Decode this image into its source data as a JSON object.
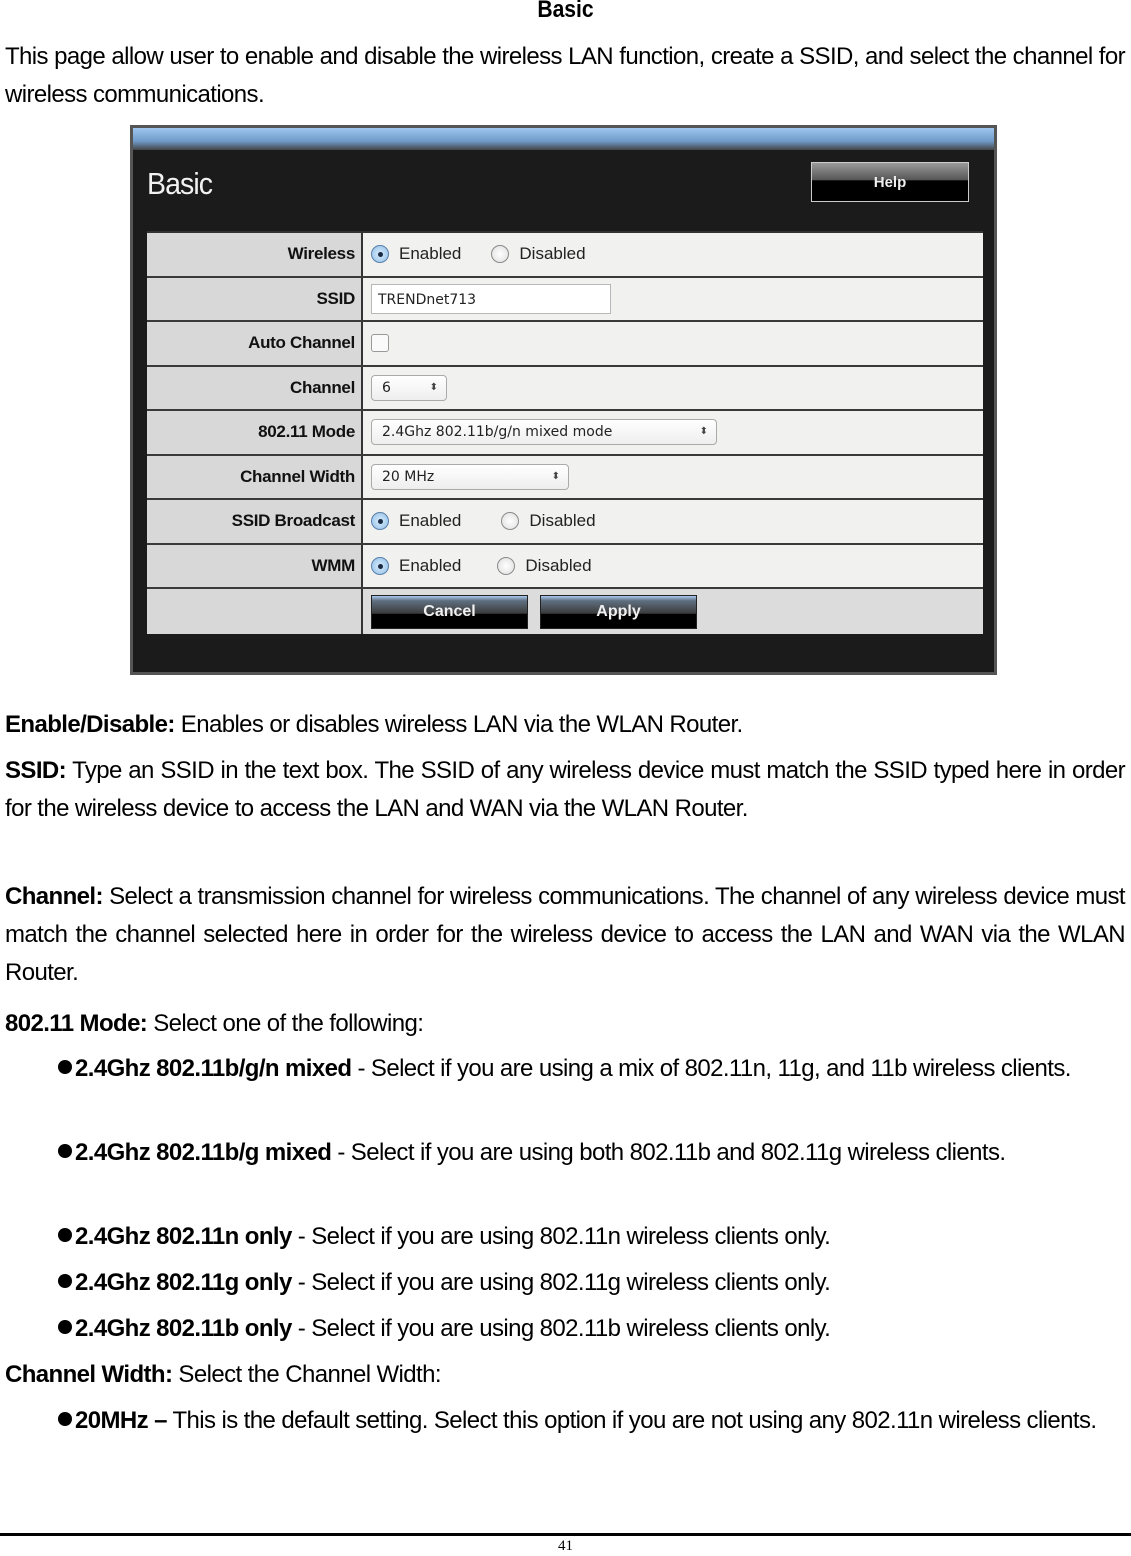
{
  "doc_title": "Basic",
  "intro": "This page allow user to enable and disable the wireless LAN function, create a SSID, and select the channel for wireless communications.",
  "screenshot": {
    "title": "Basic",
    "help_button": "Help",
    "rows": {
      "wireless": {
        "label": "Wireless",
        "options": [
          "Enabled",
          "Disabled"
        ],
        "selected": "Enabled"
      },
      "ssid": {
        "label": "SSID",
        "value": "TRENDnet713"
      },
      "auto_channel": {
        "label": "Auto Channel",
        "checked": false
      },
      "channel": {
        "label": "Channel",
        "value": "6"
      },
      "mode": {
        "label": "802.11 Mode",
        "value": "2.4Ghz 802.11b/g/n mixed mode"
      },
      "channel_width": {
        "label": "Channel Width",
        "value": "20 MHz"
      },
      "ssid_broadcast": {
        "label": "SSID Broadcast",
        "options": [
          "Enabled",
          "Disabled"
        ],
        "selected": "Enabled"
      },
      "wmm": {
        "label": "WMM",
        "options": [
          "Enabled",
          "Disabled"
        ],
        "selected": "Enabled"
      }
    },
    "cancel_button": "Cancel",
    "apply_button": "Apply",
    "select_arrows": "⬍"
  },
  "sections": {
    "enable": {
      "term": "Enable/Disable:",
      "text": " Enables or disables wireless LAN via the WLAN Router."
    },
    "ssid": {
      "term": "SSID:",
      "text": " Type an SSID in the text box. The SSID of any wireless device must match the SSID typed here in order for the wireless device to access the LAN and WAN via the WLAN Router."
    },
    "channel": {
      "term": "Channel:",
      "text": " Select a transmission channel for wireless communications. The channel of any wireless device must match the channel selected here in order for the wireless device to access the LAN and WAN via the WLAN Router."
    },
    "mode": {
      "term": "802.11 Mode:",
      "text": " Select one of the following:"
    },
    "mode_items": [
      {
        "term": "2.4Ghz 802.11b/g/n mixed",
        "text": " - Select if you are using a mix of 802.11n, 11g, and 11b wireless clients."
      },
      {
        "term": "2.4Ghz 802.11b/g mixed",
        "text": " - Select if you are using both 802.11b and 802.11g wireless clients."
      },
      {
        "term": "2.4Ghz 802.11n only",
        "text": " - Select if you are using 802.11n wireless clients only."
      },
      {
        "term": "2.4Ghz 802.11g only",
        "text": " - Select if you are using 802.11g wireless clients only."
      },
      {
        "term": "2.4Ghz 802.11b only",
        "text": " - Select if you are using 802.11b wireless clients only."
      }
    ],
    "width": {
      "term": "Channel Width:",
      "text": " Select the Channel Width:"
    },
    "width_items": [
      {
        "term": "20MHz –",
        "text": " This is the default setting. Select this option if you are not using any 802.11n wireless clients."
      }
    ]
  },
  "page_number": "41"
}
